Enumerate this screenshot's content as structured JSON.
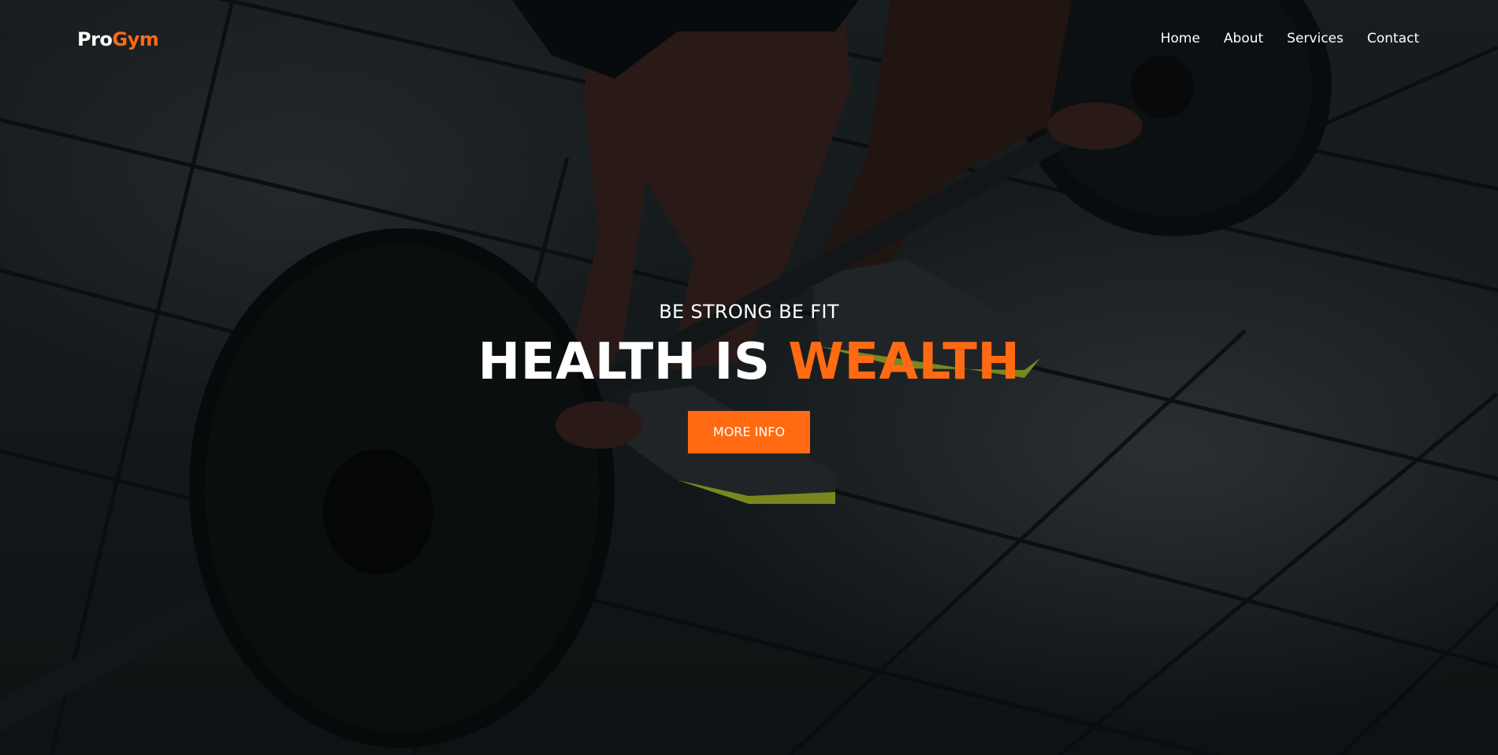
{
  "brand": {
    "logo_primary": "Pro",
    "logo_accent": "Gym",
    "accent_color": "#ff6a13"
  },
  "nav": {
    "items": [
      {
        "label": "Home"
      },
      {
        "label": "About"
      },
      {
        "label": "Services"
      },
      {
        "label": "Contact"
      }
    ]
  },
  "hero": {
    "background_image": "deadlift-barbell-gym-floor-photo",
    "tagline": "BE STRONG BE FIT",
    "headline_primary": "HEALTH IS ",
    "headline_accent": "WEALTH",
    "cta_label": "MORE INFO"
  }
}
